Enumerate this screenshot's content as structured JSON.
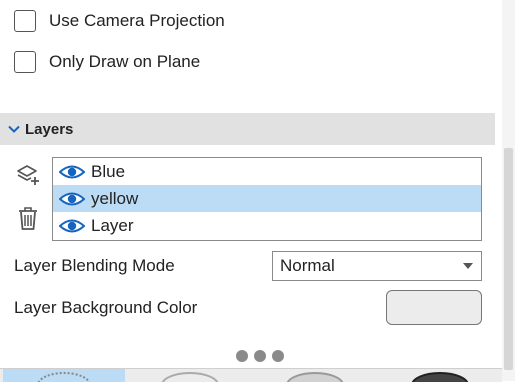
{
  "options": {
    "use_camera_projection": {
      "label": "Use Camera Projection",
      "checked": false
    },
    "only_draw_on_plane": {
      "label": "Only Draw on Plane",
      "checked": false
    }
  },
  "layers_section": {
    "title": "Layers",
    "expanded": true,
    "tools": {
      "add_icon": "add-layer-icon",
      "delete_icon": "trash-icon"
    },
    "items": [
      {
        "label": "Blue",
        "visible": true,
        "selected": false
      },
      {
        "label": "yellow",
        "visible": true,
        "selected": true
      },
      {
        "label": "Layer",
        "visible": true,
        "selected": false
      }
    ]
  },
  "blending": {
    "label": "Layer Blending Mode",
    "value": "Normal"
  },
  "background": {
    "label": "Layer Background Color",
    "color": "#ececec"
  },
  "colors": {
    "selection": "#bcdcf5",
    "accent": "#1565c0",
    "header_bg": "#e1e1e1"
  },
  "brushes": {
    "selected_index": 0
  }
}
